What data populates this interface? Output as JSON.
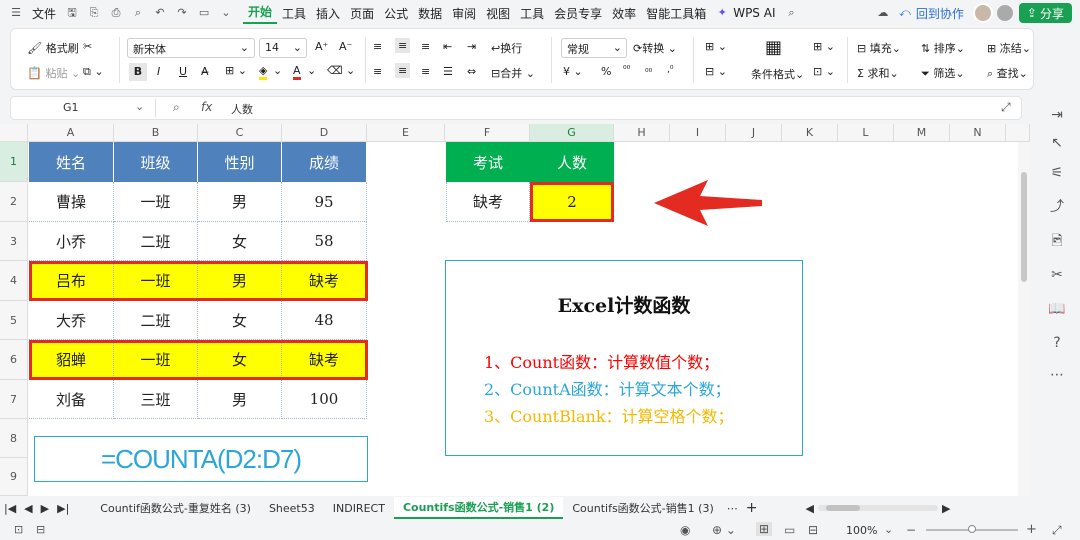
{
  "menu": {
    "file": "文件",
    "tabs": [
      "开始",
      "工具",
      "插入",
      "页面",
      "公式",
      "数据",
      "审阅",
      "视图",
      "工具",
      "会员专享",
      "效率",
      "智能工具箱"
    ],
    "wps_ai": "WPS AI",
    "collab": "回到协作",
    "share": "分享"
  },
  "ribbon": {
    "format_painter": "格式刷",
    "paste": "粘贴",
    "font_name": "新宋体",
    "font_size": "14",
    "bold": "B",
    "italic": "I",
    "underline": "U",
    "wrap": "换行",
    "merge": "合并",
    "number_format": "常规",
    "convert": "转换",
    "currency": "¥",
    "percent": "%",
    "cond_format": "条件格式",
    "fill": "填充",
    "sort": "排序",
    "freeze": "冻结",
    "sum": "求和",
    "filter": "筛选",
    "find": "查找"
  },
  "formula_bar": {
    "name_box": "G1",
    "fx": "fx",
    "content": "人数"
  },
  "columns": [
    "A",
    "B",
    "C",
    "D",
    "E",
    "F",
    "G",
    "H",
    "I",
    "J",
    "K",
    "L",
    "M",
    "N"
  ],
  "rows": [
    "1",
    "2",
    "3",
    "4",
    "5",
    "6",
    "7",
    "8",
    "9"
  ],
  "table": {
    "headers": [
      "姓名",
      "班级",
      "性别",
      "成绩"
    ],
    "rows": [
      [
        "曹操",
        "一班",
        "男",
        "95"
      ],
      [
        "小乔",
        "二班",
        "女",
        "58"
      ],
      [
        "吕布",
        "一班",
        "男",
        "缺考"
      ],
      [
        "大乔",
        "二班",
        "女",
        "48"
      ],
      [
        "貂蝉",
        "一班",
        "女",
        "缺考"
      ],
      [
        "刘备",
        "三班",
        "男",
        "100"
      ]
    ],
    "highlight_color": "#ffff00",
    "header_color": "#4f81bd"
  },
  "formula_box": "=COUNTA(D2:D7)",
  "result": {
    "headers": [
      "考试",
      "人数"
    ],
    "label": "缺考",
    "value": "2",
    "header_color": "#00b050"
  },
  "info": {
    "title": "Excel计数函数",
    "line1": "1、Count函数：计算数值个数；",
    "line2": "2、CountA函数：计算文本个数；",
    "line3": "3、CountBlank：计算空格个数；",
    "color1": "#ff0000",
    "color2": "#2aa7d8",
    "color3": "#f5b800"
  },
  "sheet_tabs": [
    "Countif函数公式-重复姓名 (3)",
    "Sheet53",
    "INDIRECT",
    "Countifs函数公式-销售1 (2)",
    "Countifs函数公式-销售1 (3)"
  ],
  "active_sheet_index": 3,
  "status": {
    "zoom": "100%"
  }
}
